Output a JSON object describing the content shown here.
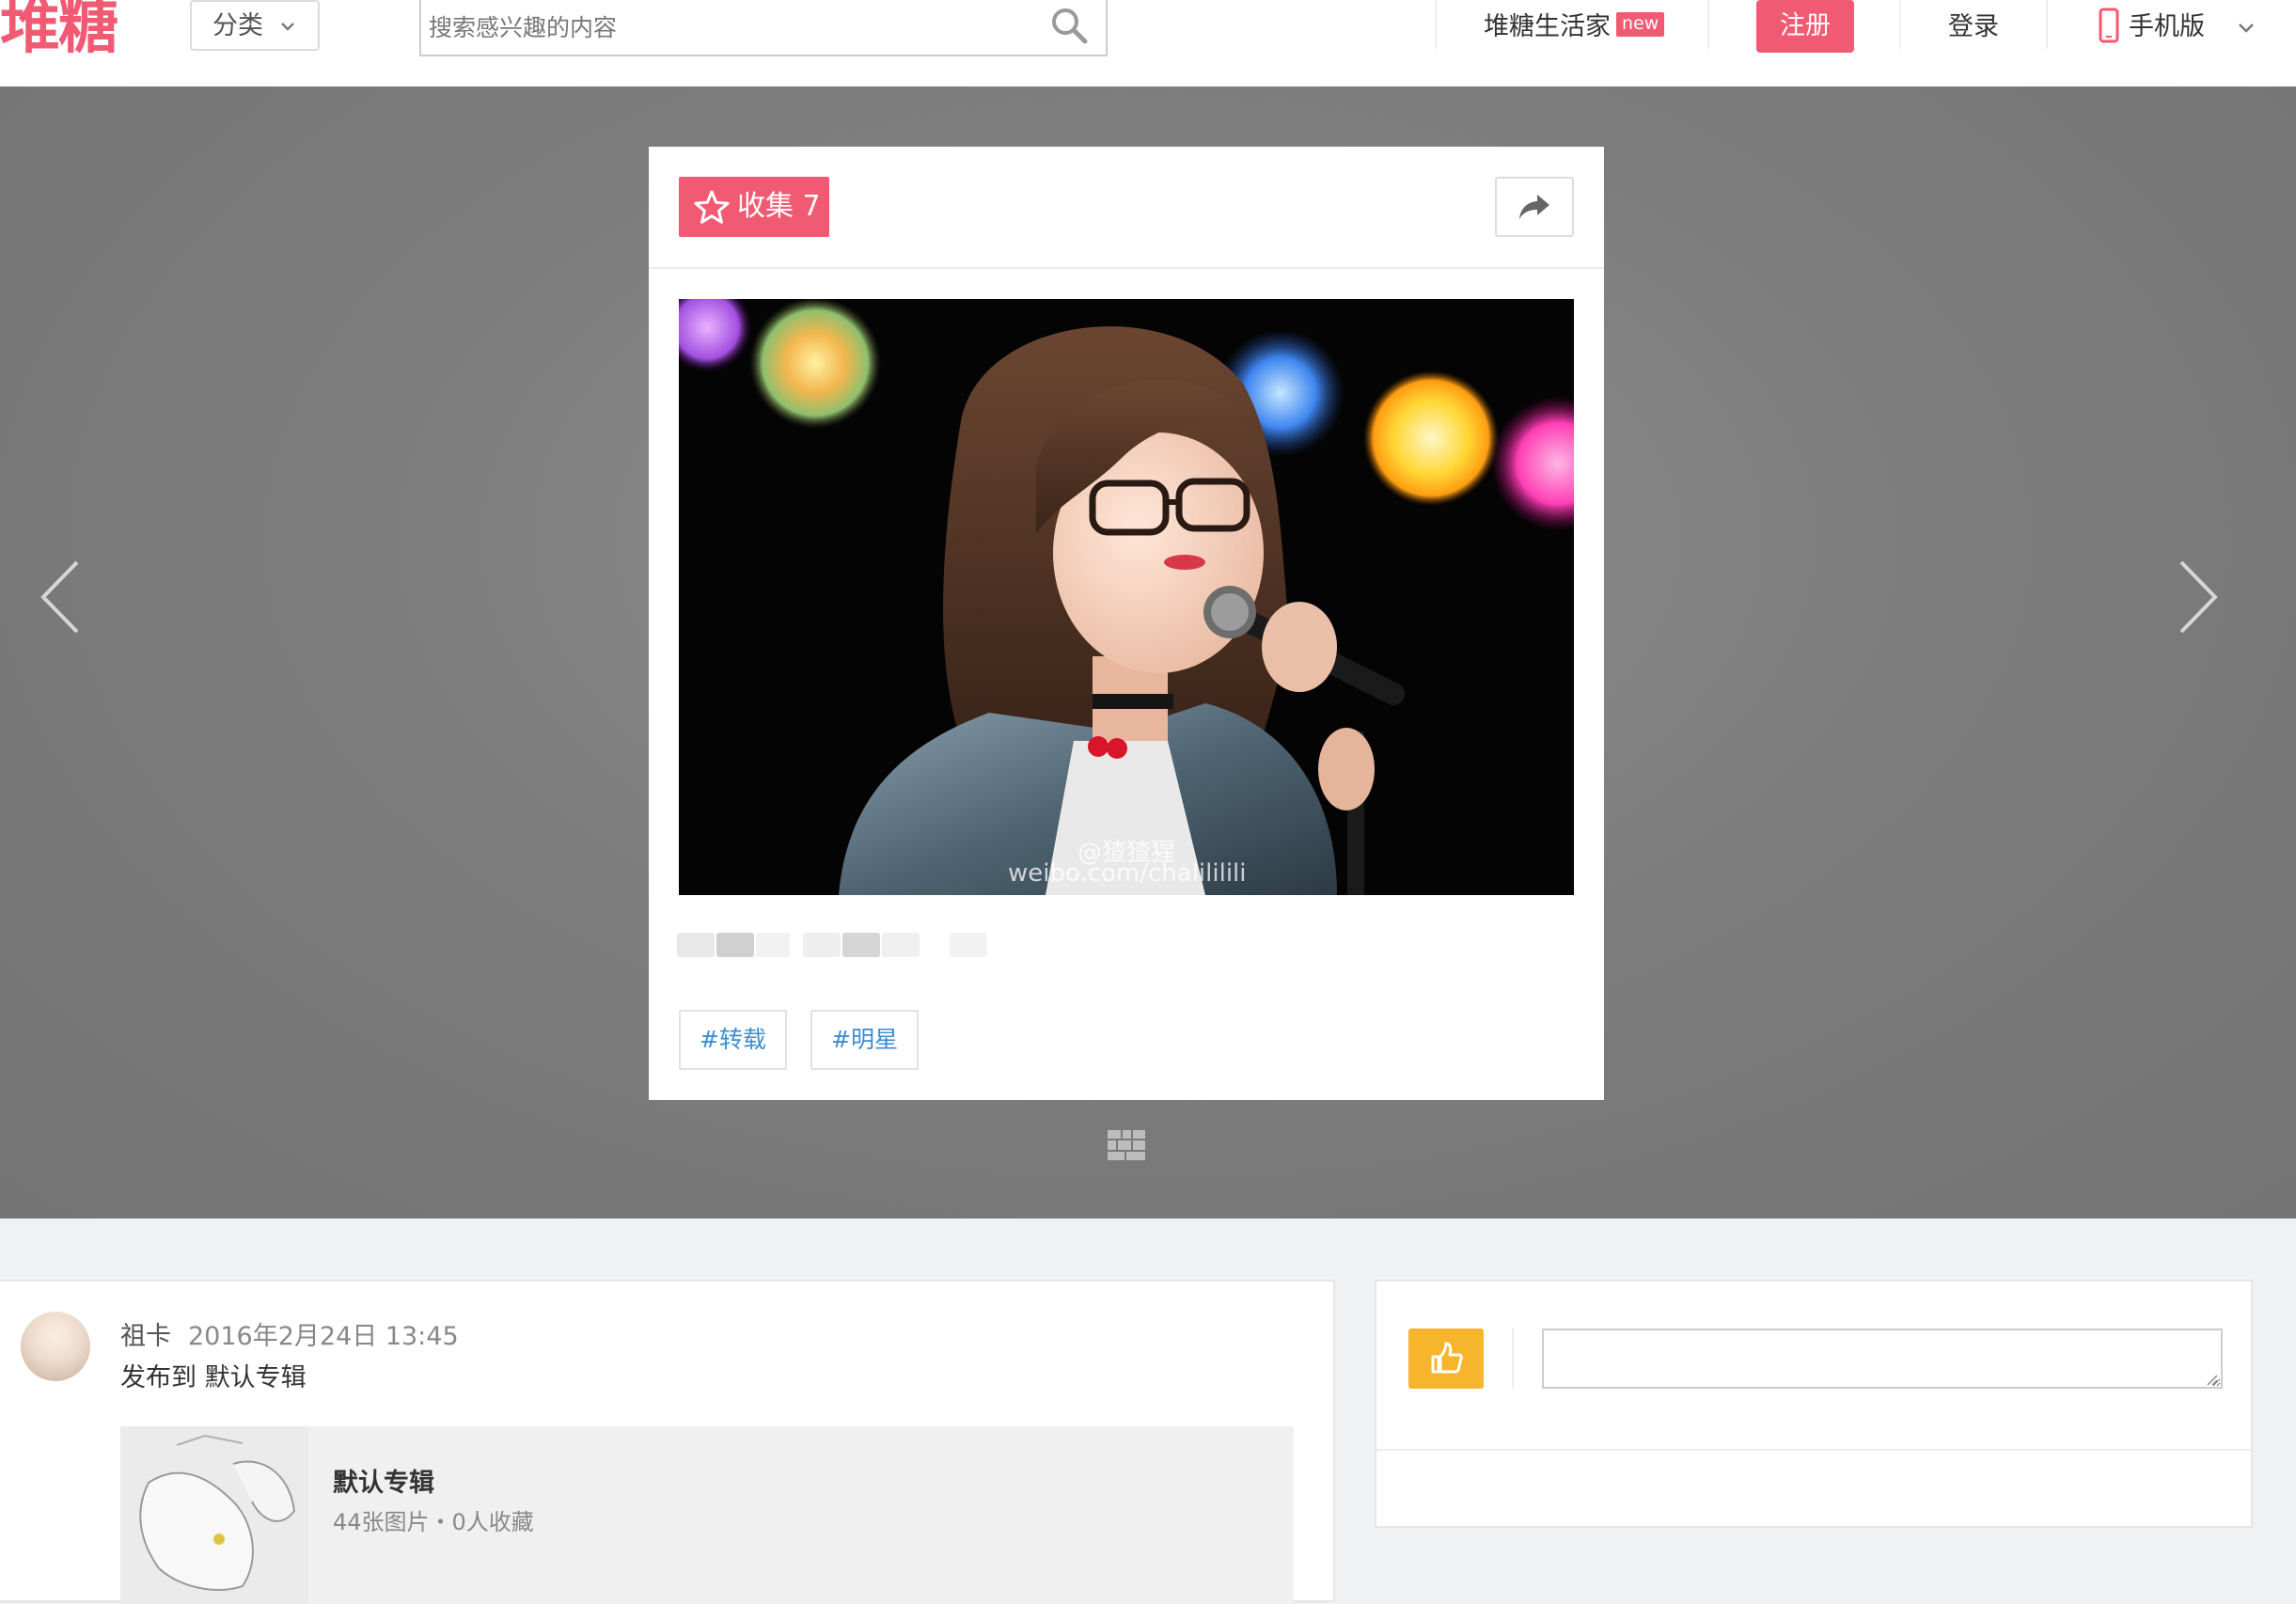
{
  "header": {
    "logo": "堆糖",
    "category_label": "分类",
    "search_placeholder": "搜索感兴趣的内容",
    "life_label": "堆糖生活家",
    "new_badge": "new",
    "register_label": "注册",
    "login_label": "登录",
    "mobile_label": "手机版"
  },
  "card": {
    "collect_label": "收集 7",
    "watermark_line1": "@猹猹猩",
    "watermark_line2": "weibo.com/chalililili",
    "tags": [
      "#转载",
      "#明星"
    ]
  },
  "post": {
    "username": "祖卡",
    "timestamp": "2016年2月24日 13:45",
    "published_to": "发布到 默认专辑",
    "album": {
      "title": "默认专辑",
      "stats": "44张图片・0人收藏"
    }
  },
  "colors": {
    "brand": "#f15a73",
    "like": "#f7b52c",
    "tag_text": "#3a8ed4"
  },
  "icons": [
    "chevron-down-icon",
    "search-icon",
    "phone-icon",
    "star-icon",
    "share-icon",
    "arrow-left-icon",
    "arrow-right-icon",
    "grid-view-icon",
    "thumbs-up-icon"
  ]
}
